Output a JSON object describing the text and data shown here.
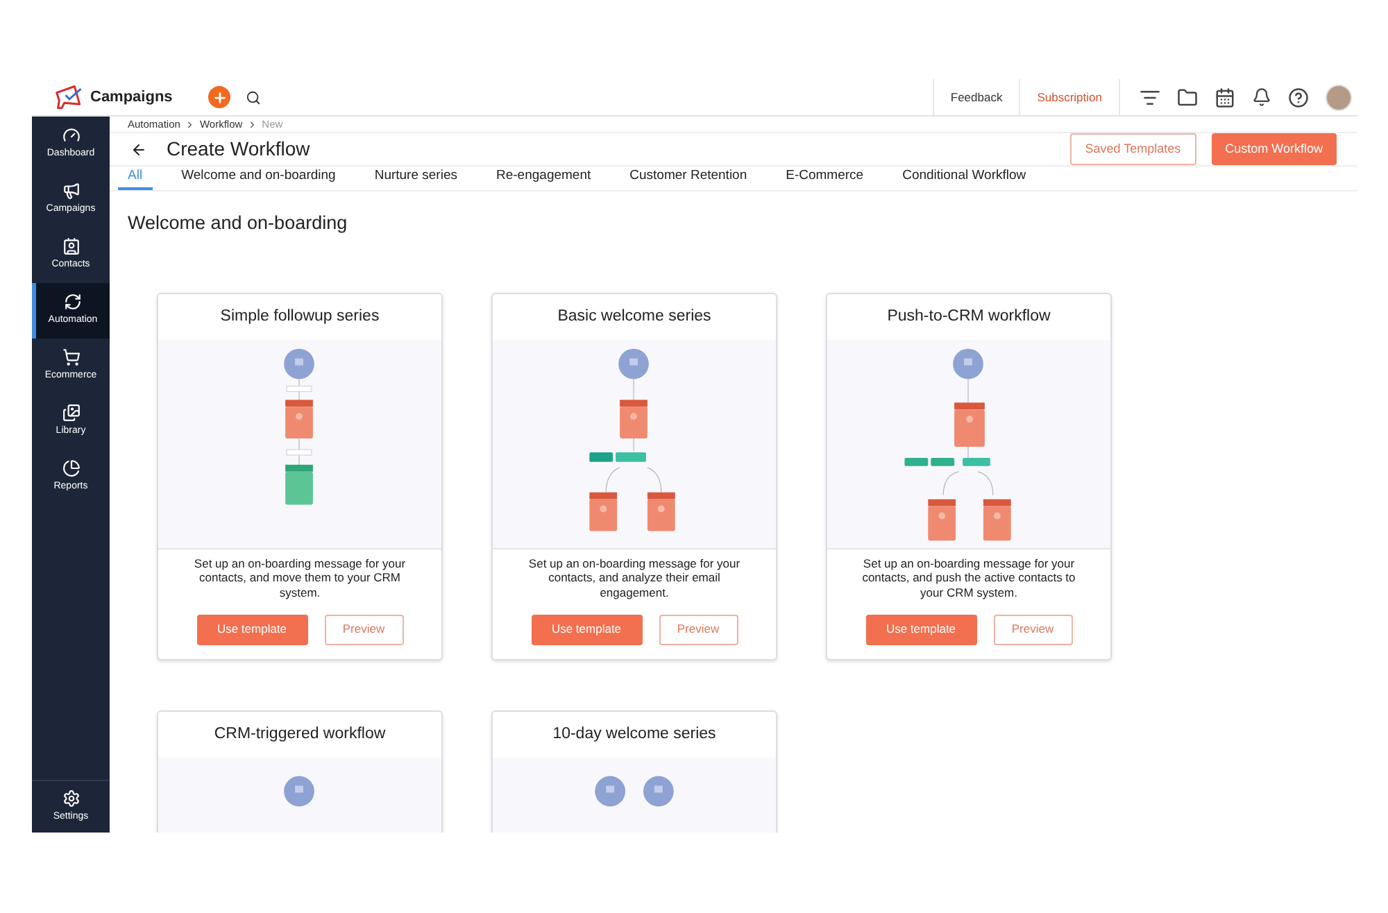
{
  "app": {
    "name": "Campaigns"
  },
  "topbar": {
    "links": [
      {
        "label": "Feedback",
        "kind": "plain"
      },
      {
        "label": "Subscription",
        "kind": "accent"
      }
    ]
  },
  "sidebar": {
    "items": [
      {
        "label": "Dashboard",
        "selected": false
      },
      {
        "label": "Campaigns",
        "selected": false
      },
      {
        "label": "Contacts",
        "selected": false
      },
      {
        "label": "Automation",
        "selected": true
      },
      {
        "label": "Ecommerce",
        "selected": false
      },
      {
        "label": "Library",
        "selected": false
      },
      {
        "label": "Reports",
        "selected": false
      }
    ],
    "footer": {
      "label": "Settings"
    }
  },
  "breadcrumb": [
    {
      "label": "Automation",
      "current": false
    },
    {
      "label": "Workflow",
      "current": false
    },
    {
      "label": "New",
      "current": true
    }
  ],
  "page": {
    "title": "Create Workflow",
    "buttons": [
      {
        "label": "Saved Templates",
        "kind": "outline"
      },
      {
        "label": "Custom Workflow",
        "kind": "primary"
      }
    ]
  },
  "tabs": [
    {
      "label": "All",
      "selected": true
    },
    {
      "label": "Welcome and on-boarding",
      "selected": false
    },
    {
      "label": "Nurture series",
      "selected": false
    },
    {
      "label": "Re-engagement",
      "selected": false
    },
    {
      "label": "Customer Retention",
      "selected": false
    },
    {
      "label": "E-Commerce",
      "selected": false
    },
    {
      "label": "Conditional Workflow",
      "selected": false
    }
  ],
  "section": {
    "title": "Welcome and on-boarding"
  },
  "cards": [
    {
      "title": "Simple followup series",
      "kind": "linear",
      "description": "Set up an on-boarding message for your contacts, and move them to your CRM system.",
      "primary": "Use template",
      "secondary": "Preview"
    },
    {
      "title": "Basic welcome series",
      "kind": "split",
      "description": "Set up an on-boarding message for your contacts, and analyze their email engagement.",
      "primary": "Use template",
      "secondary": "Preview"
    },
    {
      "title": "Push-to-CRM workflow",
      "kind": "push",
      "description": "Set up an on-boarding message for your contacts, and push the active contacts to your CRM system.",
      "primary": "Use template",
      "secondary": "Preview"
    },
    {
      "title": "CRM-triggered workflow",
      "kind": "one-start"
    },
    {
      "title": "10-day welcome series",
      "kind": "two-start"
    }
  ]
}
